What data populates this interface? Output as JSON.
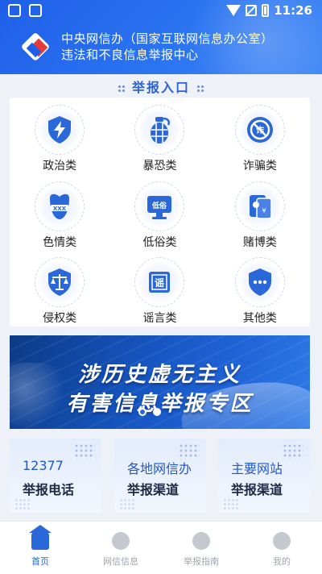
{
  "status_bar": {
    "time": "11:26"
  },
  "header": {
    "title_line1": "中央网信办（国家互联网信息办公室）",
    "title_line2": "违法和不良信息举报中心"
  },
  "section": {
    "title": "举报入口"
  },
  "categories": [
    {
      "label": "政治类",
      "icon": "shield-lightning-icon"
    },
    {
      "label": "暴恐类",
      "icon": "grenade-icon"
    },
    {
      "label": "诈骗类",
      "icon": "no-fraud-icon"
    },
    {
      "label": "色情类",
      "icon": "adult-content-icon"
    },
    {
      "label": "低俗类",
      "icon": "vulgar-monitor-icon"
    },
    {
      "label": "赌博类",
      "icon": "playing-cards-icon"
    },
    {
      "label": "侵权类",
      "icon": "scales-icon"
    },
    {
      "label": "谣言类",
      "icon": "rumor-icon"
    },
    {
      "label": "其他类",
      "icon": "shield-more-icon"
    }
  ],
  "banner": {
    "line1": "涉历史虚无主义",
    "line2": "有害信息举报专区",
    "slides": 2,
    "active_slide": 2
  },
  "quick_links": [
    {
      "top": "12377",
      "bottom": "举报电话"
    },
    {
      "top": "各地网信办",
      "bottom": "举报渠道"
    },
    {
      "top": "主要网站",
      "bottom": "举报渠道"
    }
  ],
  "bottom_nav": [
    {
      "label": "首页",
      "icon": "home-icon",
      "active": true
    },
    {
      "label": "网信信息",
      "icon": "list-icon",
      "active": false
    },
    {
      "label": "举报指南",
      "icon": "compass-icon",
      "active": false
    },
    {
      "label": "我的",
      "icon": "user-icon",
      "active": false
    }
  ],
  "colors": {
    "primary": "#2a67d9",
    "header": "#2b6cf0",
    "accent_red": "#e63a3a"
  }
}
